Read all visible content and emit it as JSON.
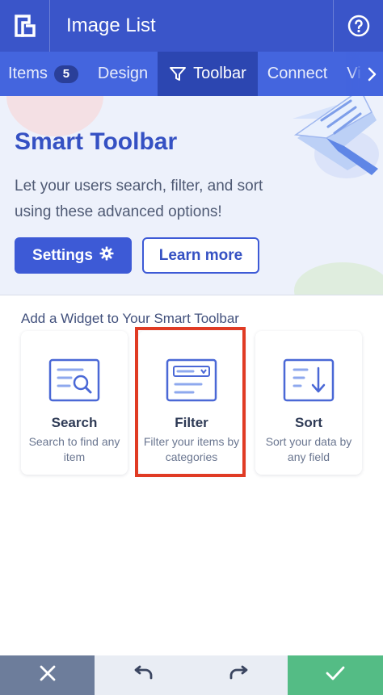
{
  "header": {
    "title": "Image List",
    "logo_icon": "logo-icon",
    "help_icon": "help-icon"
  },
  "tabs": [
    {
      "label": "Items",
      "badge": "5"
    },
    {
      "label": "Design"
    },
    {
      "label": "Toolbar",
      "icon": "funnel-icon",
      "active": true
    },
    {
      "label": "Connect"
    },
    {
      "label": "Vi"
    }
  ],
  "banner": {
    "title": "Smart Toolbar",
    "text": "Let your users search, filter, and sort using these advanced options!",
    "settings_label": "Settings",
    "learn_label": "Learn more"
  },
  "widgets": {
    "heading": "Add a Widget to Your Smart Toolbar",
    "items": [
      {
        "name": "Search",
        "desc": "Search to find any item",
        "icon": "search-widget-icon"
      },
      {
        "name": "Filter",
        "desc": "Filter your items by categories",
        "icon": "filter-widget-icon",
        "highlighted": true
      },
      {
        "name": "Sort",
        "desc": "Sort your data by any field",
        "icon": "sort-widget-icon"
      }
    ]
  },
  "bottom_bar": {
    "close_icon": "close-icon",
    "undo_icon": "undo-icon",
    "redo_icon": "redo-icon",
    "confirm_icon": "check-icon"
  },
  "colors": {
    "header": "#3a55c9",
    "tabs": "#4465de",
    "active_tab": "#2c46b1",
    "accent": "#3d5ad6",
    "confirm": "#54bc85",
    "highlight": "#e03b24"
  }
}
